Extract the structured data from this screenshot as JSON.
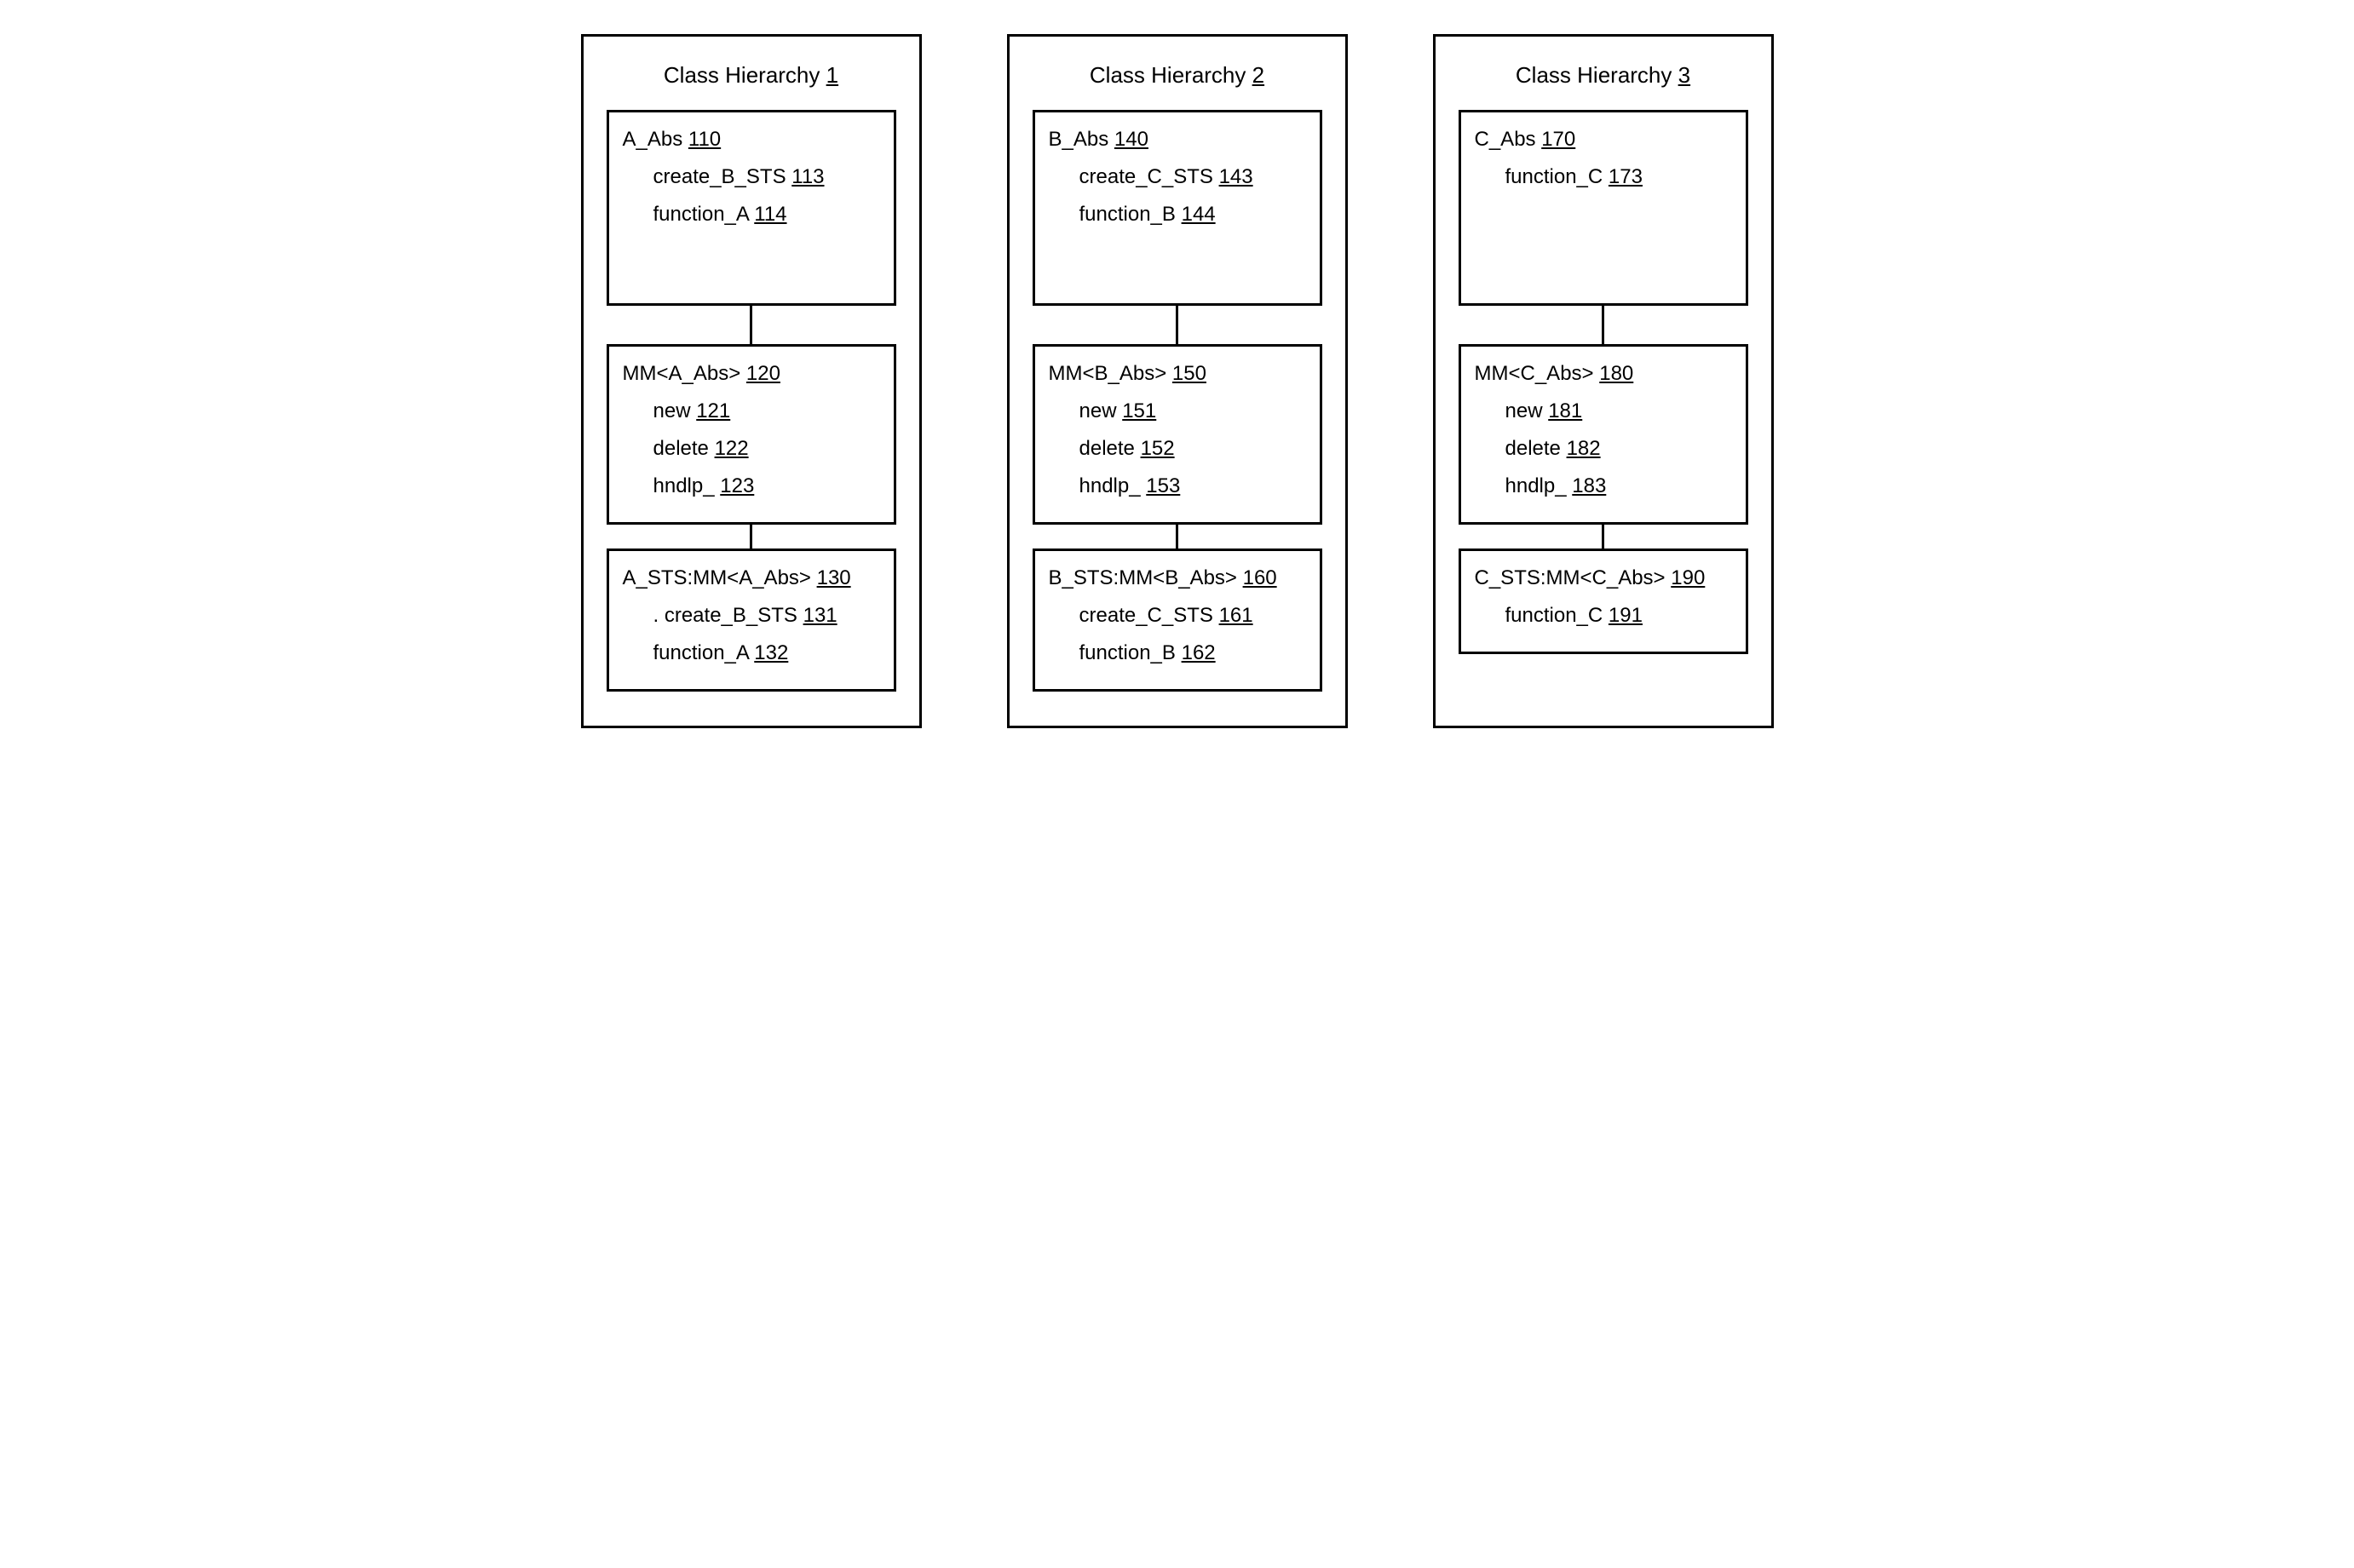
{
  "hierarchies": [
    {
      "title_prefix": "Class Hierarchy ",
      "title_num": "1",
      "boxes": [
        {
          "header_name": "A_Abs ",
          "header_ref": "110",
          "members": [
            {
              "name": "create_B_STS ",
              "ref": "113"
            },
            {
              "name": "function_A ",
              "ref": "114"
            }
          ],
          "tall": true
        },
        {
          "header_name": "MM<A_Abs> ",
          "header_ref": "120",
          "members": [
            {
              "name": "new ",
              "ref": "121"
            },
            {
              "name": "delete ",
              "ref": "122"
            },
            {
              "name": "hndlp_ ",
              "ref": "123"
            }
          ]
        },
        {
          "header_name": "A_STS:MM<A_Abs> ",
          "header_ref": "130",
          "members": [
            {
              "name": "create_B_STS ",
              "ref": "131",
              "dot": true
            },
            {
              "name": "function_A ",
              "ref": "132"
            }
          ]
        }
      ]
    },
    {
      "title_prefix": "Class Hierarchy ",
      "title_num": "2",
      "boxes": [
        {
          "header_name": "B_Abs ",
          "header_ref": "140",
          "members": [
            {
              "name": "create_C_STS ",
              "ref": "143"
            },
            {
              "name": "function_B ",
              "ref": "144"
            }
          ],
          "tall": true
        },
        {
          "header_name": "MM<B_Abs> ",
          "header_ref": "150",
          "members": [
            {
              "name": "new ",
              "ref": "151"
            },
            {
              "name": "delete ",
              "ref": "152"
            },
            {
              "name": "hndlp_ ",
              "ref": "153"
            }
          ]
        },
        {
          "header_name": "B_STS:MM<B_Abs> ",
          "header_ref": "160",
          "members": [
            {
              "name": "create_C_STS ",
              "ref": "161"
            },
            {
              "name": "function_B ",
              "ref": "162"
            }
          ]
        }
      ]
    },
    {
      "title_prefix": "Class Hierarchy ",
      "title_num": "3",
      "boxes": [
        {
          "header_name": "C_Abs ",
          "header_ref": "170",
          "members": [
            {
              "name": "function_C ",
              "ref": "173"
            }
          ],
          "tall": true
        },
        {
          "header_name": "MM<C_Abs> ",
          "header_ref": "180",
          "members": [
            {
              "name": "new ",
              "ref": "181"
            },
            {
              "name": "delete ",
              "ref": "182"
            },
            {
              "name": "hndlp_ ",
              "ref": "183"
            }
          ]
        },
        {
          "header_name": "C_STS:MM<C_Abs> ",
          "header_ref": "190",
          "members": [
            {
              "name": "function_C ",
              "ref": "191"
            }
          ]
        }
      ]
    }
  ]
}
